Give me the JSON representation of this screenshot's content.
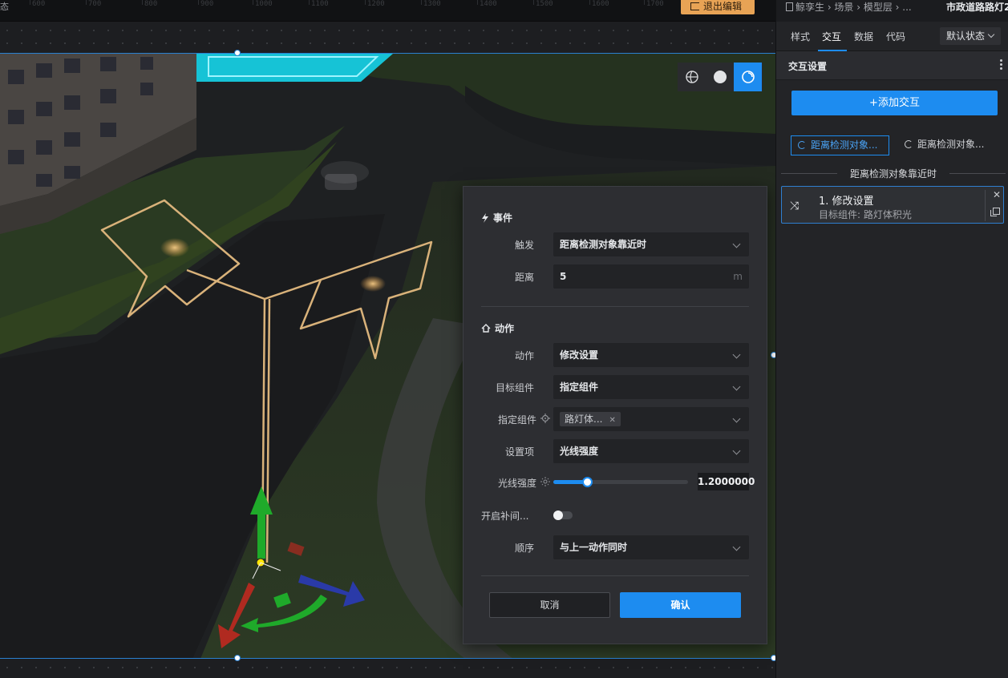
{
  "ruler": {
    "mode_text": "态",
    "ticks": [
      "600",
      "700",
      "800",
      "900",
      "1000",
      "1100",
      "1200",
      "1300",
      "1400",
      "1500",
      "1600",
      "1700"
    ],
    "exit_label": "退出编辑"
  },
  "view_tools": [
    "globe-icon",
    "sphere-icon",
    "orbit-icon"
  ],
  "popup": {
    "event_section": "事件",
    "trigger_label": "触发",
    "trigger_value": "距离检测对象靠近时",
    "distance_label": "距离",
    "distance_value": "5",
    "distance_unit": "m",
    "action_section": "动作",
    "action_label": "动作",
    "action_value": "修改设置",
    "target_label": "目标组件",
    "target_value": "指定组件",
    "specified_label": "指定组件",
    "specified_tag": "路灯体...",
    "setting_label": "设置项",
    "setting_value": "光线强度",
    "intensity_label": "光线强度",
    "intensity_value": "1.2000000",
    "intensity_fraction": 0.25,
    "tween_label": "开启补间...",
    "tween_enabled": false,
    "order_label": "顺序",
    "order_value": "与上一动作同时",
    "cancel_label": "取消",
    "confirm_label": "确认"
  },
  "panel": {
    "breadcrumb": "鲸孪生 › 场景 › 模型层 › ...",
    "component_name": "市政道路路灯2",
    "tabs": [
      {
        "label": "样式",
        "active": false
      },
      {
        "label": "交互",
        "active": true
      },
      {
        "label": "数据",
        "active": false
      },
      {
        "label": "代码",
        "active": false
      }
    ],
    "state_value": "默认状态",
    "section_title": "交互设置",
    "add_label": "+添加交互",
    "event_tabs": [
      "距离检测对象...",
      "距离检测对象..."
    ],
    "group_title": "距离检测对象靠近时",
    "action_title": "1. 修改设置",
    "action_subtitle": "目标组件: 路灯体积光"
  },
  "colors": {
    "accent": "#1d8cf0",
    "exit_button": "#e8a355",
    "selection_outline": "#d9b27a"
  }
}
